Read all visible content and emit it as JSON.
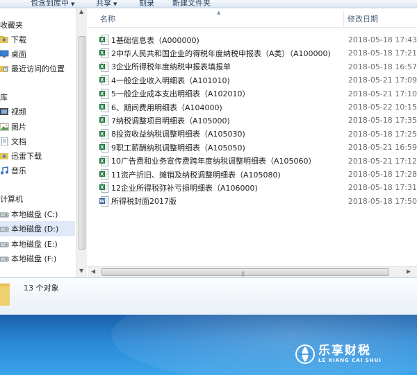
{
  "toolbar": {
    "items": [
      {
        "label": "包含到库中",
        "has_dropdown": true
      },
      {
        "label": "共享",
        "has_dropdown": true
      },
      {
        "label": "刻录",
        "has_dropdown": false
      },
      {
        "label": "新建文件夹",
        "has_dropdown": false
      }
    ]
  },
  "nav": {
    "favorites_heading": "收藏夹",
    "favorites": [
      "下载",
      "桌面",
      "最近访问的位置"
    ],
    "libraries_heading": "库",
    "libraries": [
      "视频",
      "图片",
      "文档",
      "迅雷下载",
      "音乐"
    ],
    "computer_heading": "计算机",
    "drives": [
      "本地磁盘 (C:)",
      "本地磁盘 (D:)",
      "本地磁盘 (E:)",
      "本地磁盘 (F:)"
    ],
    "selected_drive": "本地磁盘 (D:)"
  },
  "columns": {
    "name": "名称",
    "date": "修改日期"
  },
  "files": [
    {
      "name": "1基础信息表（A000000)",
      "date": "2018-05-18 17:43",
      "type": "excel"
    },
    {
      "name": "2中华人民共和国企业的得税年度纳税申报表（A类）（A100000)",
      "date": "2018-05-18 17:21",
      "type": "excel"
    },
    {
      "name": "3企业所得税年度纳税申报表填报单",
      "date": "2018-05-18 16:57",
      "type": "excel"
    },
    {
      "name": "4一般企业收入明细表（A101010)",
      "date": "2018-05-21 17:09",
      "type": "excel"
    },
    {
      "name": "5一般企业成本支出明细表（A102010）",
      "date": "2018-05-21 17:10",
      "type": "excel"
    },
    {
      "name": "6、期间费用明细表（A104000)",
      "date": "2018-05-22 10:15",
      "type": "excel"
    },
    {
      "name": "7纳税调整项目明细表（A105000)",
      "date": "2018-05-18 17:35",
      "type": "excel"
    },
    {
      "name": "8投资收益纳税调整明细表（A105030)",
      "date": "2018-05-18 17:25",
      "type": "excel"
    },
    {
      "name": "9职工薪酬纳税调整明细表（A105050)",
      "date": "2018-05-21 16:59",
      "type": "excel"
    },
    {
      "name": "10广告费和业务宣传费跨年度纳税调整明细表（A105060）",
      "date": "2018-05-21 17:12",
      "type": "excel"
    },
    {
      "name": "11资产折旧、摊销及纳税调整明细表（A105080)",
      "date": "2018-05-18 17:28",
      "type": "excel"
    },
    {
      "name": "12企业所得税弥补亏损明细表（A106000)",
      "date": "2018-05-18 17:31",
      "type": "excel"
    },
    {
      "name": "所得税封面2017版",
      "date": "2018-05-18 17:50",
      "type": "word"
    }
  ],
  "details": {
    "count": "13 个对象"
  },
  "logo": {
    "cn": "乐享财税",
    "en": "LE XIANG CAI SHUI"
  },
  "colors": {
    "excel": "#1f7a3c",
    "word": "#2b5797",
    "selected": "#dfe9f7",
    "desktop": "#2a88d6"
  }
}
